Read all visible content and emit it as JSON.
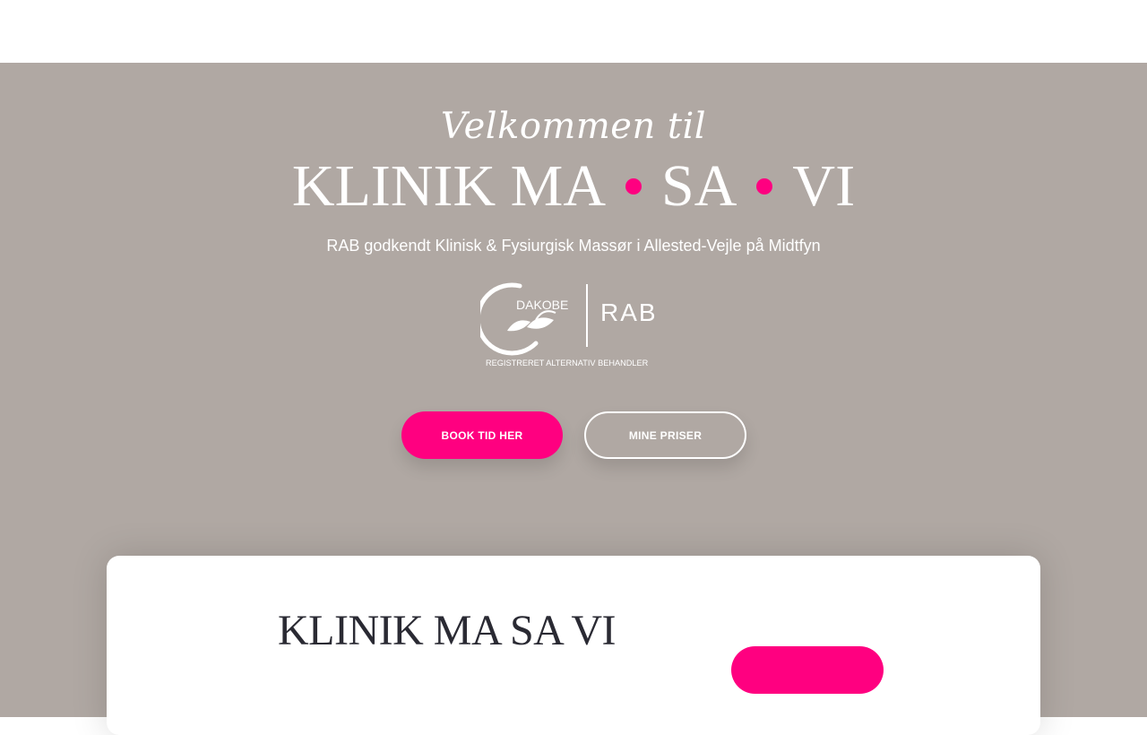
{
  "colors": {
    "accent": "#ff0080",
    "hero_bg": "#b0a8a3",
    "text_light": "#ffffff",
    "text_dark": "#2a2a33"
  },
  "hero": {
    "welcome": "Velkommen til",
    "brand_parts": [
      "KLINIK MA",
      "SA",
      "VI"
    ],
    "subtitle": "RAB godkendt Klinisk & Fysiurgisk Massør i Allested-Vejle på Midtfyn",
    "logo": {
      "icon": "leaf-logo-icon",
      "left_text": "DAKOBE",
      "right_text": "RAB",
      "caption": "REGISTRERET ALTERNATIV BEHANDLER"
    },
    "book_button": "BOOK TID HER",
    "prices_button": "MINE PRISER"
  },
  "card": {
    "title": "KLINIK MA SA VI"
  }
}
